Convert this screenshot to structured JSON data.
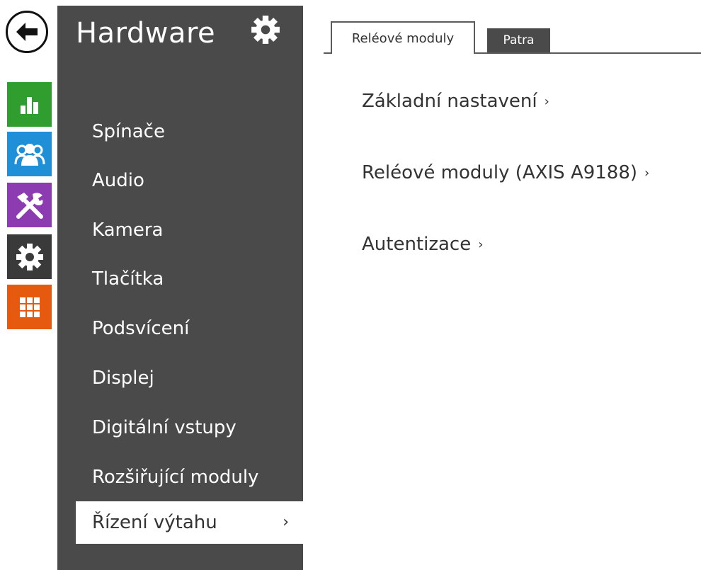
{
  "rail": {
    "back_icon": "arrow-left-icon",
    "items": [
      {
        "icon": "bar-chart-icon",
        "color": "#2f9e2f"
      },
      {
        "icon": "users-icon",
        "color": "#1f8fd8"
      },
      {
        "icon": "tools-icon",
        "color": "#8c3bb0"
      },
      {
        "icon": "gear-icon",
        "color": "#3a3a3a"
      },
      {
        "icon": "grid-icon",
        "color": "#e65a10"
      }
    ]
  },
  "menu": {
    "title": "Hardware",
    "title_icon": "gear-icon",
    "items": [
      {
        "label": "Spínače"
      },
      {
        "label": "Audio"
      },
      {
        "label": "Kamera"
      },
      {
        "label": "Tlačítka"
      },
      {
        "label": "Podsvícení"
      },
      {
        "label": "Displej"
      },
      {
        "label": "Digitální vstupy"
      },
      {
        "label": "Rozšiřující moduly"
      },
      {
        "label": "Řízení výtahu",
        "active": true,
        "chevron": "›"
      }
    ]
  },
  "tabs": [
    {
      "label": "Reléové moduly",
      "active": true
    },
    {
      "label": "Patra",
      "active": false
    }
  ],
  "main": {
    "links": [
      {
        "label": "Základní nastavení",
        "chevron": "›"
      },
      {
        "label": "Reléové moduly (AXIS A9188)",
        "chevron": "›"
      },
      {
        "label": "Autentizace",
        "chevron": "›"
      }
    ]
  }
}
